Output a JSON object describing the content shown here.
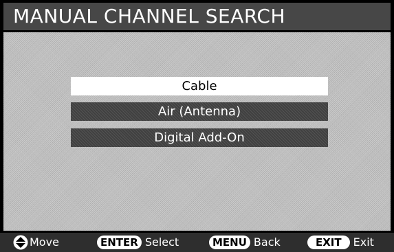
{
  "header": {
    "title": "MANUAL CHANNEL SEARCH"
  },
  "menu": {
    "items": [
      {
        "label": "Cable",
        "selected": true
      },
      {
        "label": "Air (Antenna)",
        "selected": false
      },
      {
        "label": "Digital Add-On",
        "selected": false
      }
    ]
  },
  "footer": {
    "move": {
      "icon": "up-down-arrow-icon",
      "label": "Move"
    },
    "enter": {
      "key": "ENTER",
      "label": "Select"
    },
    "menu": {
      "key": "MENU",
      "label": "Back"
    },
    "exit": {
      "key": "EXIT",
      "label": "Exit"
    }
  },
  "colors": {
    "title_bar": "#474747",
    "panel": "#c2c2c2",
    "item_bg": "#404040",
    "item_selected_bg": "#ffffff",
    "footer_bg": "#2e2e2e"
  }
}
